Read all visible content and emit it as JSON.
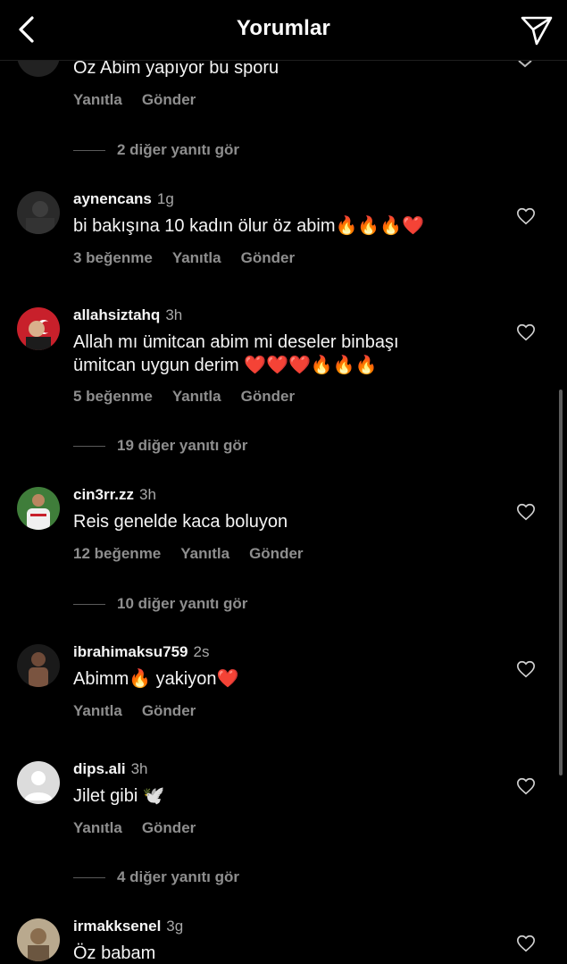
{
  "header": {
    "title": "Yorumlar",
    "back_icon": "chevron-left-icon",
    "send_icon": "paper-plane-icon"
  },
  "partial_comment": {
    "text": "Oz Abim yapıyor bu sporu",
    "reply_label": "Yanıtla",
    "send_label": "Gönder",
    "view_replies": "2 diğer yanıtı gör"
  },
  "comments": [
    {
      "username": "aynencans",
      "time": "1g",
      "text": "bi bakışına  10 kadın ölur öz abim🔥🔥🔥❤️",
      "likes": "3 beğenme",
      "reply_label": "Yanıtla",
      "send_label": "Gönder",
      "view_replies": ""
    },
    {
      "username": "allahsiztahq",
      "time": "3h",
      "text": "Allah mı ümitcan abim mi deseler binbaşı ümitcan uygun derim ❤️❤️❤️🔥🔥🔥",
      "likes": "5 beğenme",
      "reply_label": "Yanıtla",
      "send_label": "Gönder",
      "view_replies": "19 diğer yanıtı gör"
    },
    {
      "username": "cin3rr.zz",
      "time": "3h",
      "text": "Reis genelde kaca boluyon",
      "likes": "12 beğenme",
      "reply_label": "Yanıtla",
      "send_label": "Gönder",
      "view_replies": "10 diğer yanıtı gör"
    },
    {
      "username": "ibrahimaksu759",
      "time": "2s",
      "text": "Abimm🔥 yakiyon❤️",
      "likes": "",
      "reply_label": "Yanıtla",
      "send_label": "Gönder",
      "view_replies": ""
    },
    {
      "username": "dips.ali",
      "time": "3h",
      "text": "Jilet gibi 🕊️",
      "likes": "",
      "reply_label": "Yanıtla",
      "send_label": "Gönder",
      "view_replies": "4 diğer yanıtı gör"
    },
    {
      "username": "irmakksenel",
      "time": "3g",
      "text": "Öz babam",
      "likes": "",
      "reply_label": "",
      "send_label": "",
      "view_replies": ""
    }
  ],
  "colors": {
    "background": "#000000",
    "text": "#f5f5f5",
    "muted": "#8e8e8e",
    "heart_emoji": "#e0245e",
    "fire_emoji": "#ff8c1a"
  },
  "icons": {
    "like": "heart-outline-icon",
    "avatar_placeholder": "default-avatar-icon"
  }
}
